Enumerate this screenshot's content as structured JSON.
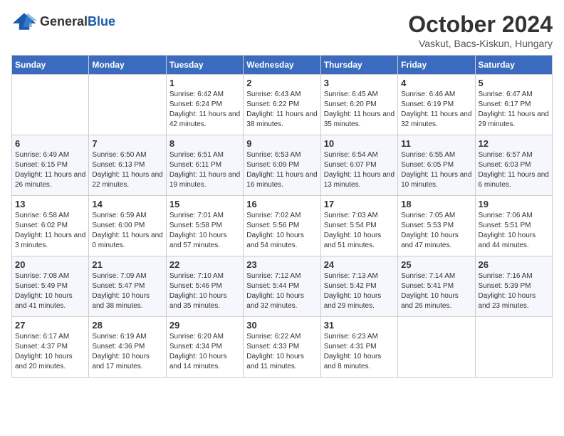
{
  "header": {
    "logo_general": "General",
    "logo_blue": "Blue",
    "month_title": "October 2024",
    "location": "Vaskut, Bacs-Kiskun, Hungary"
  },
  "weekdays": [
    "Sunday",
    "Monday",
    "Tuesday",
    "Wednesday",
    "Thursday",
    "Friday",
    "Saturday"
  ],
  "weeks": [
    [
      {
        "day": "",
        "sunrise": "",
        "sunset": "",
        "daylight": ""
      },
      {
        "day": "",
        "sunrise": "",
        "sunset": "",
        "daylight": ""
      },
      {
        "day": "1",
        "sunrise": "Sunrise: 6:42 AM",
        "sunset": "Sunset: 6:24 PM",
        "daylight": "Daylight: 11 hours and 42 minutes."
      },
      {
        "day": "2",
        "sunrise": "Sunrise: 6:43 AM",
        "sunset": "Sunset: 6:22 PM",
        "daylight": "Daylight: 11 hours and 38 minutes."
      },
      {
        "day": "3",
        "sunrise": "Sunrise: 6:45 AM",
        "sunset": "Sunset: 6:20 PM",
        "daylight": "Daylight: 11 hours and 35 minutes."
      },
      {
        "day": "4",
        "sunrise": "Sunrise: 6:46 AM",
        "sunset": "Sunset: 6:19 PM",
        "daylight": "Daylight: 11 hours and 32 minutes."
      },
      {
        "day": "5",
        "sunrise": "Sunrise: 6:47 AM",
        "sunset": "Sunset: 6:17 PM",
        "daylight": "Daylight: 11 hours and 29 minutes."
      }
    ],
    [
      {
        "day": "6",
        "sunrise": "Sunrise: 6:49 AM",
        "sunset": "Sunset: 6:15 PM",
        "daylight": "Daylight: 11 hours and 26 minutes."
      },
      {
        "day": "7",
        "sunrise": "Sunrise: 6:50 AM",
        "sunset": "Sunset: 6:13 PM",
        "daylight": "Daylight: 11 hours and 22 minutes."
      },
      {
        "day": "8",
        "sunrise": "Sunrise: 6:51 AM",
        "sunset": "Sunset: 6:11 PM",
        "daylight": "Daylight: 11 hours and 19 minutes."
      },
      {
        "day": "9",
        "sunrise": "Sunrise: 6:53 AM",
        "sunset": "Sunset: 6:09 PM",
        "daylight": "Daylight: 11 hours and 16 minutes."
      },
      {
        "day": "10",
        "sunrise": "Sunrise: 6:54 AM",
        "sunset": "Sunset: 6:07 PM",
        "daylight": "Daylight: 11 hours and 13 minutes."
      },
      {
        "day": "11",
        "sunrise": "Sunrise: 6:55 AM",
        "sunset": "Sunset: 6:05 PM",
        "daylight": "Daylight: 11 hours and 10 minutes."
      },
      {
        "day": "12",
        "sunrise": "Sunrise: 6:57 AM",
        "sunset": "Sunset: 6:03 PM",
        "daylight": "Daylight: 11 hours and 6 minutes."
      }
    ],
    [
      {
        "day": "13",
        "sunrise": "Sunrise: 6:58 AM",
        "sunset": "Sunset: 6:02 PM",
        "daylight": "Daylight: 11 hours and 3 minutes."
      },
      {
        "day": "14",
        "sunrise": "Sunrise: 6:59 AM",
        "sunset": "Sunset: 6:00 PM",
        "daylight": "Daylight: 11 hours and 0 minutes."
      },
      {
        "day": "15",
        "sunrise": "Sunrise: 7:01 AM",
        "sunset": "Sunset: 5:58 PM",
        "daylight": "Daylight: 10 hours and 57 minutes."
      },
      {
        "day": "16",
        "sunrise": "Sunrise: 7:02 AM",
        "sunset": "Sunset: 5:56 PM",
        "daylight": "Daylight: 10 hours and 54 minutes."
      },
      {
        "day": "17",
        "sunrise": "Sunrise: 7:03 AM",
        "sunset": "Sunset: 5:54 PM",
        "daylight": "Daylight: 10 hours and 51 minutes."
      },
      {
        "day": "18",
        "sunrise": "Sunrise: 7:05 AM",
        "sunset": "Sunset: 5:53 PM",
        "daylight": "Daylight: 10 hours and 47 minutes."
      },
      {
        "day": "19",
        "sunrise": "Sunrise: 7:06 AM",
        "sunset": "Sunset: 5:51 PM",
        "daylight": "Daylight: 10 hours and 44 minutes."
      }
    ],
    [
      {
        "day": "20",
        "sunrise": "Sunrise: 7:08 AM",
        "sunset": "Sunset: 5:49 PM",
        "daylight": "Daylight: 10 hours and 41 minutes."
      },
      {
        "day": "21",
        "sunrise": "Sunrise: 7:09 AM",
        "sunset": "Sunset: 5:47 PM",
        "daylight": "Daylight: 10 hours and 38 minutes."
      },
      {
        "day": "22",
        "sunrise": "Sunrise: 7:10 AM",
        "sunset": "Sunset: 5:46 PM",
        "daylight": "Daylight: 10 hours and 35 minutes."
      },
      {
        "day": "23",
        "sunrise": "Sunrise: 7:12 AM",
        "sunset": "Sunset: 5:44 PM",
        "daylight": "Daylight: 10 hours and 32 minutes."
      },
      {
        "day": "24",
        "sunrise": "Sunrise: 7:13 AM",
        "sunset": "Sunset: 5:42 PM",
        "daylight": "Daylight: 10 hours and 29 minutes."
      },
      {
        "day": "25",
        "sunrise": "Sunrise: 7:14 AM",
        "sunset": "Sunset: 5:41 PM",
        "daylight": "Daylight: 10 hours and 26 minutes."
      },
      {
        "day": "26",
        "sunrise": "Sunrise: 7:16 AM",
        "sunset": "Sunset: 5:39 PM",
        "daylight": "Daylight: 10 hours and 23 minutes."
      }
    ],
    [
      {
        "day": "27",
        "sunrise": "Sunrise: 6:17 AM",
        "sunset": "Sunset: 4:37 PM",
        "daylight": "Daylight: 10 hours and 20 minutes."
      },
      {
        "day": "28",
        "sunrise": "Sunrise: 6:19 AM",
        "sunset": "Sunset: 4:36 PM",
        "daylight": "Daylight: 10 hours and 17 minutes."
      },
      {
        "day": "29",
        "sunrise": "Sunrise: 6:20 AM",
        "sunset": "Sunset: 4:34 PM",
        "daylight": "Daylight: 10 hours and 14 minutes."
      },
      {
        "day": "30",
        "sunrise": "Sunrise: 6:22 AM",
        "sunset": "Sunset: 4:33 PM",
        "daylight": "Daylight: 10 hours and 11 minutes."
      },
      {
        "day": "31",
        "sunrise": "Sunrise: 6:23 AM",
        "sunset": "Sunset: 4:31 PM",
        "daylight": "Daylight: 10 hours and 8 minutes."
      },
      {
        "day": "",
        "sunrise": "",
        "sunset": "",
        "daylight": ""
      },
      {
        "day": "",
        "sunrise": "",
        "sunset": "",
        "daylight": ""
      }
    ]
  ]
}
